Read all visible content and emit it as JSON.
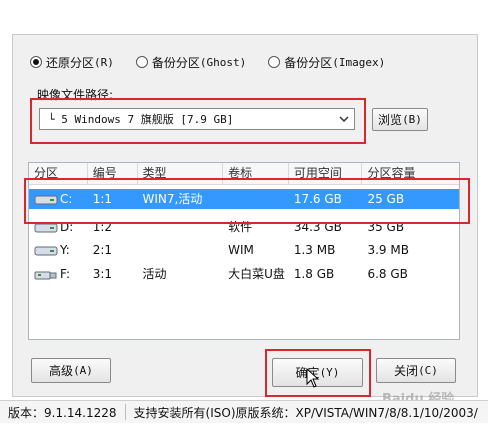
{
  "options": {
    "restore_label": "还原分区",
    "restore_key": "(R)",
    "backup_ghost_label": "备份分区",
    "backup_ghost_key": "(Ghost)",
    "backup_imagex_label": "备份分区",
    "backup_imagex_key": "(Imagex)"
  },
  "path": {
    "label": "映像文件路径:",
    "selected": "└ 5 Windows 7 旗舰版 [7.9 GB]",
    "browse_label": "浏览",
    "browse_key": "(B)"
  },
  "table": {
    "headers": [
      "分区",
      "编号",
      "类型",
      "卷标",
      "可用空间",
      "分区容量"
    ],
    "rows": [
      {
        "drive": "C:",
        "num": "1:1",
        "type": "WIN7,活动",
        "label": "",
        "free": "17.6 GB",
        "size": "25 GB"
      },
      {
        "drive": "D:",
        "num": "1:2",
        "type": "",
        "label": "软件",
        "free": "34.3 GB",
        "size": "35 GB"
      },
      {
        "drive": "Y:",
        "num": "2:1",
        "type": "",
        "label": "WIM",
        "free": "1.3 MB",
        "size": "3.9 MB"
      },
      {
        "drive": "F:",
        "num": "3:1",
        "type": "活动",
        "label": "大白菜U盘",
        "free": "1.8 GB",
        "size": "6.8 GB"
      }
    ]
  },
  "buttons": {
    "advanced_label": "高级",
    "advanced_key": "(A)",
    "ok_label": "确定",
    "ok_key": "(Y)",
    "close_label": "关闭",
    "close_key": "(C)"
  },
  "status": {
    "version": "版本：9.1.14.1228",
    "support": "支持安装所有(ISO)原版系统：XP/VISTA/WIN7/8/8.1/10/2003/"
  },
  "watermark": "Baidu 经验",
  "colors": {
    "selection": "#3399ff",
    "highlight_border": "#d9272d"
  }
}
